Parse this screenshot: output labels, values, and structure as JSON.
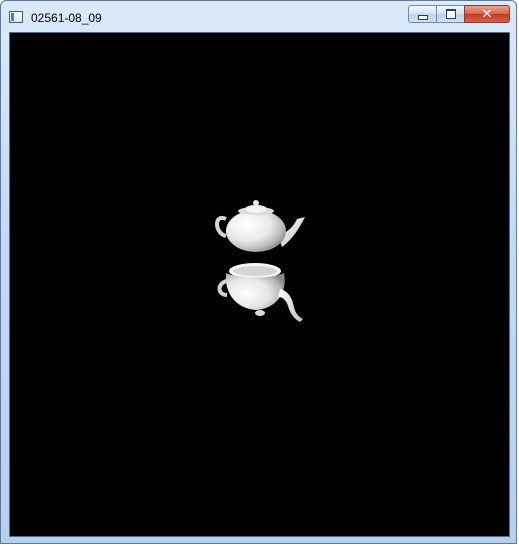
{
  "window": {
    "title": "02561-08_09",
    "icon": "app-window-icon"
  },
  "titlebar_buttons": {
    "minimize": "minimize-icon",
    "maximize": "maximize-icon",
    "close_label": "✕"
  },
  "viewport": {
    "background": "#000000",
    "objects": [
      "teapot-upright",
      "teapot-reflected-upside-down"
    ],
    "object_color": "#ffffff"
  }
}
